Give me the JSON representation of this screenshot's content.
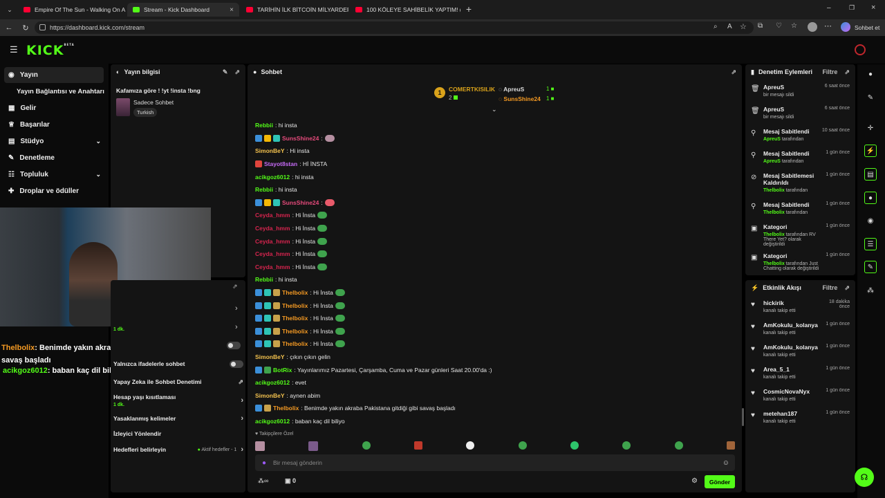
{
  "browser": {
    "tabs": [
      {
        "label": "Empire Of The Sun - Walking On A",
        "fav": "#ff0033"
      },
      {
        "label": "Stream - Kick Dashboard",
        "fav": "#53fc18"
      },
      {
        "label": "TARİHİN İLK BİTCOİN MİLYARDERİ...",
        "fav": "#ff0033"
      },
      {
        "label": "100 KÖLEYE SAHİBELİK YAPTIM! (S...",
        "fav": "#ff0033"
      }
    ],
    "url": "https://dashboard.kick.com/stream",
    "copilot_label": "Sohbet et"
  },
  "app": {
    "logo": "KICK",
    "logo_badge": "BETA"
  },
  "sidebar": {
    "items": [
      {
        "label": "Yayın",
        "icon": "broadcast-icon"
      },
      {
        "label": "Yayın Bağlantısı ve Anahtarı",
        "icon": ""
      },
      {
        "label": "Gelir",
        "icon": "revenue-icon"
      },
      {
        "label": "Başarılar",
        "icon": "trophy-icon"
      },
      {
        "label": "Stüdyo",
        "icon": "studio-icon"
      },
      {
        "label": "Denetleme",
        "icon": "wrench-icon"
      },
      {
        "label": "Topluluk",
        "icon": "community-icon"
      },
      {
        "label": "Droplar ve ödüller",
        "icon": "gift-icon"
      }
    ]
  },
  "stream_info": {
    "title": "Yayın bilgisi",
    "stream_title": "Kafamıza göre ! !yt !insta !bng",
    "category": "Sadece Sohbet",
    "tag": "Turkish"
  },
  "overlay_chat": {
    "line1_user": "Thelbolix",
    "line1_text": ": Benimde yakın akraba Pakistana gitdiği gibi savaş başladı",
    "line2_user": "acikgoz6012",
    "line2_text": ": baban kaç dil biliyo"
  },
  "chat_settings": {
    "slow_time": "1 dk.",
    "emote_only": "Yalnızca ifadelerle sohbet",
    "ai_mod": "Yapay Zeka ile Sohbet Denetimi",
    "account_age": "Hesap yaşı kısıtlaması",
    "account_age_value": "1 dk.",
    "banned_words": "Yasaklanmış kelimeler",
    "viewer_redirect": "İzleyici Yönlendir",
    "goals": "Hedefleri belirleyin",
    "goals_status": "Aktif hedefler - 1"
  },
  "chat": {
    "title": "Sohbet",
    "leaderboard": [
      {
        "rank": "1",
        "name": "COMERTKISILIK",
        "count": "2"
      },
      {
        "name": "ApreuS",
        "count": "1"
      },
      {
        "name": "SunsShine24",
        "count": "1"
      }
    ],
    "messages": [
      {
        "user": "Rebbii",
        "color": "#53fc18",
        "text": ": hi insta",
        "badges": [],
        "emote": ""
      },
      {
        "user": "SunsShine24",
        "color": "#e54a7b",
        "text": ":",
        "badges": [
          "#3b8fd9",
          "#f2b705",
          "#2ec4b6"
        ],
        "emote": "#b58fa1"
      },
      {
        "user": "SimonBeY",
        "color": "#f2c14e",
        "text": ": Hi insta",
        "badges": [],
        "emote": ""
      },
      {
        "user": "Stayot8stan",
        "color": "#c56af5",
        "text": ": Hİ İNSTA",
        "badges": [
          "#e0453d"
        ],
        "emote": ""
      },
      {
        "user": "acikgoz6012",
        "color": "#53fc18",
        "text": ": hi insta",
        "badges": [],
        "emote": ""
      },
      {
        "user": "Rebbii",
        "color": "#53fc18",
        "text": ": hi insta",
        "badges": [],
        "emote": ""
      },
      {
        "user": "SunsShine24",
        "color": "#e54a7b",
        "text": ":",
        "badges": [
          "#3b8fd9",
          "#f2b705",
          "#2ec4b6"
        ],
        "emote": "#e85a6a"
      },
      {
        "user": "Ceyda_hmm",
        "color": "#d6244e",
        "text": ": Hi İnsta",
        "badges": [],
        "emote": "#3fa34d"
      },
      {
        "user": "Ceyda_hmm",
        "color": "#d6244e",
        "text": ": Hi İnsta",
        "badges": [],
        "emote": "#3fa34d"
      },
      {
        "user": "Ceyda_hmm",
        "color": "#d6244e",
        "text": ": Hi İnsta",
        "badges": [],
        "emote": "#3fa34d"
      },
      {
        "user": "Ceyda_hmm",
        "color": "#d6244e",
        "text": ": Hi İnsta",
        "badges": [],
        "emote": "#3fa34d"
      },
      {
        "user": "Ceyda_hmm",
        "color": "#d6244e",
        "text": ": Hi İnsta",
        "badges": [],
        "emote": "#3fa34d"
      },
      {
        "user": "Rebbii",
        "color": "#53fc18",
        "text": ": hi insta",
        "badges": [],
        "emote": ""
      },
      {
        "user": "Thelbolix",
        "color": "#f59a23",
        "text": ": Hi İnsta",
        "badges": [
          "#3b8fd9",
          "#2ec4b6",
          "#c8a14a"
        ],
        "emote": "#3fa34d"
      },
      {
        "user": "Thelbolix",
        "color": "#f59a23",
        "text": ": Hi İnsta",
        "badges": [
          "#3b8fd9",
          "#2ec4b6",
          "#c8a14a"
        ],
        "emote": "#3fa34d"
      },
      {
        "user": "Thelbolix",
        "color": "#f59a23",
        "text": ": Hi İnsta",
        "badges": [
          "#3b8fd9",
          "#2ec4b6",
          "#c8a14a"
        ],
        "emote": "#3fa34d"
      },
      {
        "user": "Thelbolix",
        "color": "#f59a23",
        "text": ": Hi İnsta",
        "badges": [
          "#3b8fd9",
          "#2ec4b6",
          "#c8a14a"
        ],
        "emote": "#3fa34d"
      },
      {
        "user": "Thelbolix",
        "color": "#f59a23",
        "text": ": Hi İnsta",
        "badges": [
          "#3b8fd9",
          "#2ec4b6",
          "#c8a14a"
        ],
        "emote": "#3fa34d"
      },
      {
        "user": "SimonBeY",
        "color": "#f2c14e",
        "text": ": çıkın çıkın gelin",
        "badges": [],
        "emote": ""
      },
      {
        "user": "BotRix",
        "color": "#53fc18",
        "text": ": Yayınlarımız Pazartesi, Çarşamba, Cuma ve Pazar günleri Saat 20.00'da :)",
        "badges": [
          "#3b8fd9",
          "#3fa34d"
        ],
        "emote": ""
      },
      {
        "user": "acikgoz6012",
        "color": "#53fc18",
        "text": ": evet",
        "badges": [],
        "emote": ""
      },
      {
        "user": "SimonBeY",
        "color": "#f2c14e",
        "text": ": aynen abim",
        "badges": [],
        "emote": ""
      },
      {
        "user": "Thelbolix",
        "color": "#f59a23",
        "text": ": Benimde yakın akraba Pakistana gitdiği gibi savaş başladı",
        "badges": [
          "#3b8fd9",
          "#c8a14a"
        ],
        "emote": ""
      },
      {
        "user": "acikgoz6012",
        "color": "#53fc18",
        "text": ": baban kaç dil biliyo",
        "badges": [],
        "emote": ""
      }
    ],
    "emote_section": "Takipçilere Özel",
    "input_placeholder": "Bir mesaj gönderin",
    "infinity_label": "∞",
    "points": "0",
    "send_label": "Gönder"
  },
  "mod_actions": {
    "title": "Denetim Eylemleri",
    "filter": "Filtre",
    "items": [
      {
        "icon": "trash-icon",
        "title": "ApreuS",
        "sub1": "bir mesajı sildi",
        "sub_green": "",
        "sub_after": "",
        "time": "6 saat önce"
      },
      {
        "icon": "trash-icon",
        "title": "ApreuS",
        "sub1": "bir mesajı sildi",
        "sub_green": "",
        "sub_after": "",
        "time": "6 saat önce"
      },
      {
        "icon": "pin-icon",
        "title": "Mesaj Sabitlendi",
        "sub1": "",
        "sub_green": "ApreuS",
        "sub_after": " tarafından",
        "time": "10 saat önce"
      },
      {
        "icon": "pin-icon",
        "title": "Mesaj Sabitlendi",
        "sub1": "",
        "sub_green": "ApreuS",
        "sub_after": " tarafından",
        "time": "1 gün önce"
      },
      {
        "icon": "unpin-icon",
        "title": "Mesaj Sabitlemesi Kaldırıldı",
        "sub1": "",
        "sub_green": "Thelbolix",
        "sub_after": " tarafından",
        "time": "1 gün önce"
      },
      {
        "icon": "pin-icon",
        "title": "Mesaj Sabitlendi",
        "sub1": "",
        "sub_green": "Thelbolix",
        "sub_after": " tarafından",
        "time": "1 gün önce"
      },
      {
        "icon": "category-icon",
        "title": "Kategori",
        "sub1": "",
        "sub_green": "Thelbolix",
        "sub_after": " tarafından RV There Yet? olarak değiştirildi",
        "time": "1 gün önce"
      },
      {
        "icon": "category-icon",
        "title": "Kategori",
        "sub1": "",
        "sub_green": "Thelbolix",
        "sub_after": " tarafından Just Chatting olarak değiştirildi",
        "time": "1 gün önce"
      }
    ]
  },
  "activity": {
    "title": "Etkinlik Akışı",
    "filter": "Filtre",
    "items": [
      {
        "user": "hickirik",
        "sub": "kanalı takip etti",
        "time": "18 dakika önce"
      },
      {
        "user": "AmKokulu_kolanya",
        "sub": "kanalı takip etti",
        "time": "1 gün önce"
      },
      {
        "user": "AmKokulu_kolanya",
        "sub": "kanalı takip etti",
        "time": "1 gün önce"
      },
      {
        "user": "Area_5_1",
        "sub": "kanalı takip etti",
        "time": "1 gün önce"
      },
      {
        "user": "CosmicNovaNyx",
        "sub": "kanalı takip etti",
        "time": "1 gün önce"
      },
      {
        "user": "metehan187",
        "sub": "kanalı takip etti",
        "time": "1 gün önce"
      }
    ]
  },
  "colors": {
    "accent": "#53fc18",
    "panel": "#141414",
    "bg": "#000000"
  }
}
